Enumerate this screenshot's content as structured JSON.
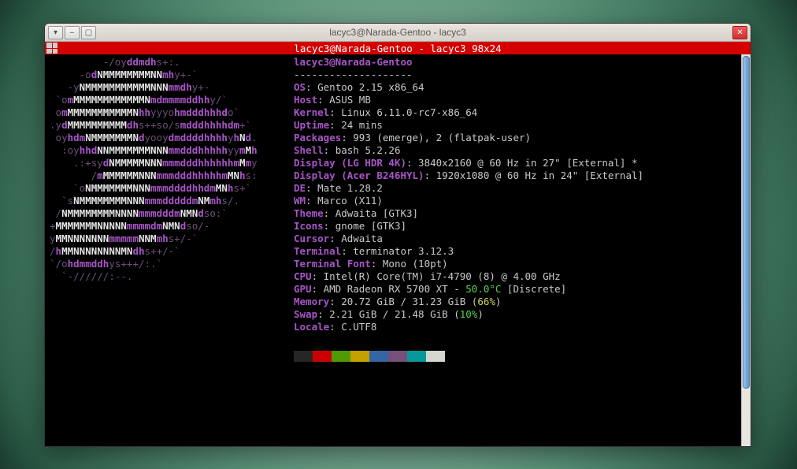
{
  "window": {
    "title": "lacyc3@Narada-Gentoo - lacyc3",
    "redbar": "lacyc3@Narada-Gentoo - lacyc3 98x24"
  },
  "logo_lines": [
    "         -/oyddmdhs+:.",
    "     -odNMMMMMMMMNNmhy+-`",
    "   -yNMMMMMMMMMMMNNNmmdhy+-",
    " `omMMMMMMMMMMMMNmdmmmmddhhy/`",
    " omMMMMMMMMMMMNhhyyyohmdddhhhdo`",
    ".ydMMMMMMMMMMdhs++so/smdddhhhhdm+`",
    " oyhdmNMMMMMMMNdyooydmddddhhhhyhNd.",
    "  :oyhhdNNMMMMMMMNNNmmdddhhhhhyymMh",
    "    .:+sydNMMMMMNNNmmmdddhhhhhhmMmy",
    "       /mMMMMMMNNNmmmdddhhhhhmMNhs:",
    "    `oNMMMMMMMNNNmmmddddhhdmMNhs+`",
    "  `sNMMMMMMMMNNNmmmdddddmNMmhs/.",
    " /NMMMMMMMMNNNNmmmdddmNMNdso:`",
    "+MMMMMMMNNNNNmmmmdmNMNdso/-",
    "yMMNNNNNNNmmmmmNNMmhs+/-`",
    "/hMMNNNNNNNNMNdhs++/-`",
    "`/ohdmmddhys+++/:.`",
    "  `-//////:--."
  ],
  "userhost": "lacyc3@Narada-Gentoo",
  "sep": "--------------------",
  "info": [
    {
      "k": "OS",
      "v": "Gentoo 2.15 x86_64"
    },
    {
      "k": "Host",
      "v": "ASUS MB"
    },
    {
      "k": "Kernel",
      "v": "Linux 6.11.0-rc7-x86_64"
    },
    {
      "k": "Uptime",
      "v": "24 mins"
    },
    {
      "k": "Packages",
      "v": "993 (emerge), 2 (flatpak-user)"
    },
    {
      "k": "Shell",
      "v": "bash 5.2.26"
    },
    {
      "k": "Display (LG HDR 4K)",
      "v": "3840x2160 @ 60 Hz in 27\" [External] *"
    },
    {
      "k": "Display (Acer B246HYL)",
      "v": "1920x1080 @ 60 Hz in 24\" [External]"
    },
    {
      "k": "DE",
      "v": "Mate 1.28.2"
    },
    {
      "k": "WM",
      "v": "Marco (X11)"
    },
    {
      "k": "Theme",
      "v": "Adwaita [GTK3]"
    },
    {
      "k": "Icons",
      "v": "gnome [GTK3]"
    },
    {
      "k": "Cursor",
      "v": "Adwaita"
    },
    {
      "k": "Terminal",
      "v": "terminator 3.12.3"
    },
    {
      "k": "Terminal Font",
      "v": "Mono (10pt)"
    },
    {
      "k": "CPU",
      "v": "Intel(R) Core(TM) i7-4790 (8) @ 4.00 GHz"
    }
  ],
  "gpu": {
    "k": "GPU",
    "pre": "AMD Radeon RX 5700 XT - ",
    "temp": "50.0°C",
    "post": " [Discrete]"
  },
  "memory": {
    "k": "Memory",
    "pre": "20.72 GiB / 31.23 GiB (",
    "pct": "66%",
    "post": ")"
  },
  "swap": {
    "k": "Swap",
    "pre": "2.21 GiB / 21.48 GiB (",
    "pct": "10%",
    "post": ")"
  },
  "locale": {
    "k": "Locale",
    "v": "C.UTF8"
  },
  "swatch_colors": [
    "#262626",
    "#cc0000",
    "#4e9a06",
    "#c4a000",
    "#3465a4",
    "#75507b",
    "#06989a",
    "#d3d7cf"
  ]
}
